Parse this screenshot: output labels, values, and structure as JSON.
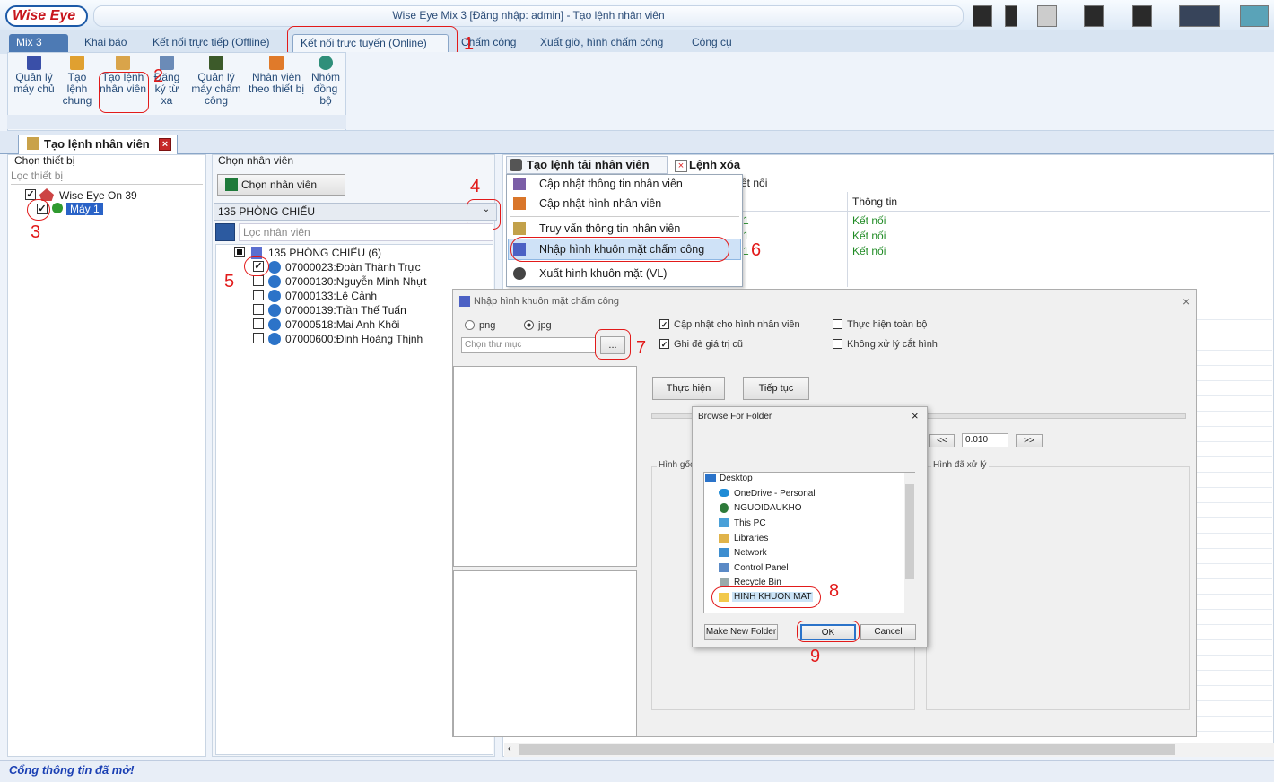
{
  "app": {
    "logo": "Wise Eye",
    "title": "Wise Eye Mix 3 [Đăng nhập: admin] - Tạo lệnh nhân viên"
  },
  "menu_tabs": [
    "Mix 3",
    "Khai báo",
    "Kết nối trực tiếp (Offline)",
    "Kết nối trực tuyến (Online)",
    "Chấm công",
    "Xuất giờ, hình chấm công",
    "Công cụ"
  ],
  "ribbon": [
    {
      "label": "Quản lý máy chủ",
      "icon": "server-icon"
    },
    {
      "label": "Tạo lệnh chung",
      "icon": "command-icon"
    },
    {
      "label": "Tạo lệnh nhân viên",
      "icon": "user-command-icon"
    },
    {
      "label": "Đăng ký từ xa",
      "icon": "remote-register-icon"
    },
    {
      "label": "Quản lý máy chấm công",
      "icon": "device-icon"
    },
    {
      "label": "Nhân viên theo thiết bị",
      "icon": "user-device-icon"
    },
    {
      "label": "Nhóm đồng bộ",
      "icon": "sync-icon"
    }
  ],
  "doc_tab": "Tạo lệnh nhân viên",
  "left": {
    "title": "Chọn thiết bị",
    "filter": "Lọc thiết bị",
    "root": "Wise Eye On 39",
    "child": "Máy 1"
  },
  "middle": {
    "title": "Chọn nhân viên",
    "button": "Chọn nhân viên",
    "combo": "135 PHÒNG CHIẾU",
    "filter": "Lọc nhân viên",
    "group": "135 PHÒNG CHIẾU (6)",
    "employees": [
      "07000023:Đoàn Thành Trực",
      "07000130:Nguyễn Minh Nhựt",
      "07000133:Lê Cảnh",
      "07000139:Trần Thế Tuấn",
      "07000518:Mai Anh Khôi",
      "07000600:Đinh Hoàng Thịnh"
    ]
  },
  "right": {
    "tab1": "Tạo lệnh tải nhân viên",
    "tab2": "Lệnh xóa",
    "col_connect": "ết nối",
    "col_info": "Thông tin",
    "rows": [
      "Kết nối",
      "Kết nối",
      "Kết nối"
    ],
    "row_prefix": "1"
  },
  "dropdown": [
    "Cập nhật thông tin nhân viên",
    "Cập nhật hình nhân viên",
    "Truy vấn thông tin nhân viên",
    "Nhập hình khuôn mặt chấm công",
    "Xuất hình khuôn mặt (VL)"
  ],
  "import_dialog": {
    "title": "Nhập hình khuôn mặt chấm công",
    "png": "png",
    "jpg": "jpg",
    "folder_placeholder": "Chọn thư mục",
    "browse": "...",
    "opt1": "Cập nhật cho hình nhân viên",
    "opt2": "Ghi đè giá trị cũ",
    "opt3": "Thực hiện toàn bộ",
    "opt4": "Không xử lý cắt hình",
    "run": "Thực hiện",
    "next": "Tiếp tục",
    "prev": "<<",
    "nextpage": ">>",
    "step": "0.010",
    "orig": "Hình gốc",
    "processed": "Hình đã xử lý"
  },
  "browse_dialog": {
    "title": "Browse For Folder",
    "items": [
      "Desktop",
      "OneDrive - Personal",
      "NGUOIDAUKHO",
      "This PC",
      "Libraries",
      "Network",
      "Control Panel",
      "Recycle Bin",
      "HINH KHUON MAT"
    ],
    "new_folder": "Make New Folder",
    "ok": "OK",
    "cancel": "Cancel"
  },
  "annotations": [
    "1",
    "2",
    "3",
    "4",
    "5",
    "6",
    "7",
    "8",
    "9"
  ],
  "status": "Cổng thông tin đã mở!"
}
